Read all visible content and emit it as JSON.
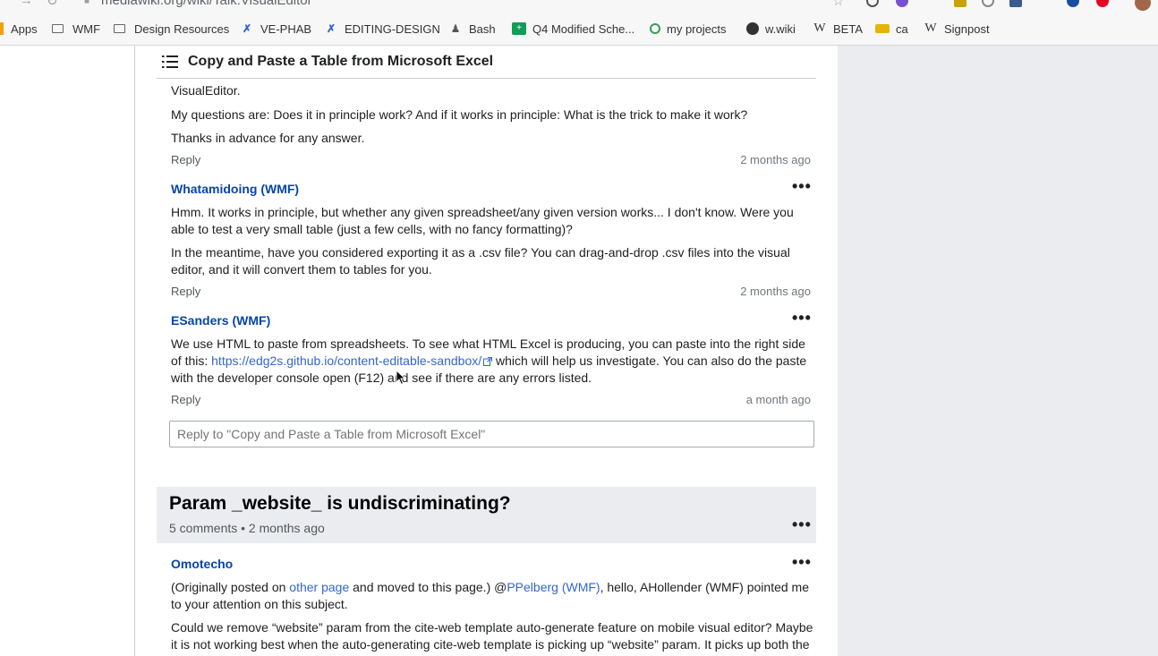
{
  "browser": {
    "url": "mediawiki.org/wiki/Talk:VisualEditor",
    "bookmarks": [
      {
        "label": "Apps",
        "icon": "apps-grid-icon"
      },
      {
        "label": "WMF",
        "icon": "folder-icon"
      },
      {
        "label": "Design Resources",
        "icon": "folder-icon"
      },
      {
        "label": "VE-PHAB",
        "icon": "phabricator-icon"
      },
      {
        "label": "EDITING-DESIGN",
        "icon": "phabricator-icon"
      },
      {
        "label": "Bash",
        "icon": "bash-icon"
      },
      {
        "label": "Q4 Modified Sche...",
        "icon": "sheets-icon"
      },
      {
        "label": "my projects",
        "icon": "projects-icon"
      },
      {
        "label": "w.wiki",
        "icon": "globe-icon"
      },
      {
        "label": "BETA",
        "icon": "wikipedia-icon"
      },
      {
        "label": "ca",
        "icon": "ca-icon"
      },
      {
        "label": "Signpost",
        "icon": "wikipedia-icon"
      }
    ]
  },
  "sticky_header": {
    "title": "Copy and Paste a Table from Microsoft Excel"
  },
  "thread1": {
    "partial_line": "VisualEditor.",
    "line2": "My questions are: Does it in principle work? And if it works in principle: What is the trick to make it work?",
    "line3": "Thanks in advance for any answer.",
    "reply": "Reply",
    "time": "2 months ago"
  },
  "comment2": {
    "user": "Whatamidoing (WMF)",
    "para1": "Hmm. It works in principle, but whether any given spreadsheet/any given version works... I don't know. Were you able to test a very small table (just a few cells, with no fancy formatting)?",
    "para2": "In the meantime, have you considered exporting it as a .csv file? You can drag-and-drop .csv files into the visual editor, and it will convert them to tables for you.",
    "reply": "Reply",
    "time": "2 months ago"
  },
  "comment3": {
    "user": "ESanders (WMF)",
    "text_before": "We use HTML to paste from spreadsheets. To see what HTML Excel is producing, you can paste into the right side of this: ",
    "link": "https://edg2s.github.io/content-editable-sandbox/",
    "text_after": " which will help us investigate. You can also do the paste with the developer console open (F12) and see if there are any errors listed.",
    "reply": "Reply",
    "time": "a month ago"
  },
  "reply_box": {
    "placeholder": "Reply to \"Copy and Paste a Table from Microsoft Excel\""
  },
  "topic2": {
    "title": "Param _website_ is undiscriminating?",
    "meta": "5 comments • 2 months ago"
  },
  "comment4": {
    "user": "Omotecho",
    "p1_before": "(Originally posted on ",
    "p1_link1": "other page",
    "p1_mid": " and moved to this page.) @",
    "p1_link2": "PPelberg (WMF)",
    "p1_after": ", hello, AHollender (WMF) pointed me to your attention on this subject.",
    "para2": "Could we remove “website” param from the cite-web template auto-generate feature on mobile visual editor? Maybe it is not working best when the auto-generating cite-web template is picking up “website” param. It picks up both the"
  },
  "colors": {
    "link": "#3366cc",
    "username": "#0645ad",
    "topic_bg": "#eaecf0"
  }
}
